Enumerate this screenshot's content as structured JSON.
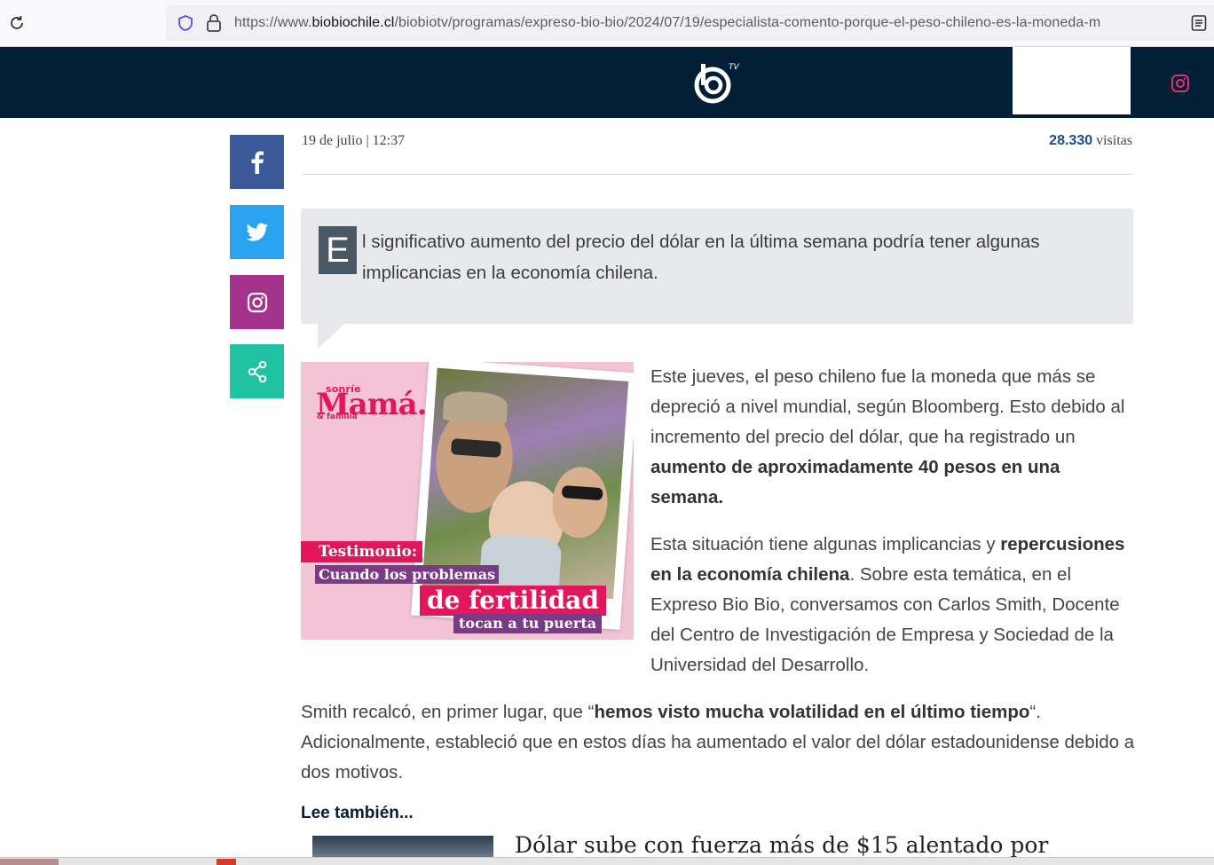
{
  "browser": {
    "url_host_prefix": "https://www.",
    "url_host": "biobiochile.cl",
    "url_path": "/biobiotv/programas/expreso-bio-bio/2024/07/19/especialista-comento-porque-el-peso-chileno-es-la-moneda-m"
  },
  "header": {
    "logo_icon": "biobiotv-logo",
    "instagram_icon": "instagram-icon",
    "accent_color": "#031f38"
  },
  "share": {
    "facebook_icon": "facebook-icon",
    "twitter_icon": "twitter-icon",
    "instagram_icon": "instagram-icon",
    "share_icon": "share-icon",
    "colors": {
      "facebook": "#3b5998",
      "twitter": "#2aa3ef",
      "instagram": "#a4338e",
      "share": "#21c2a4"
    }
  },
  "meta": {
    "date": "19 de julio | 12:37",
    "visits_count": "28.330",
    "visits_label": "visitas"
  },
  "lead": {
    "dropcap": "E",
    "text": "l significativo aumento del precio del dólar en la última semana podría tener algunas implicancias en la economía chilena."
  },
  "ad": {
    "brand_small": "sonríe",
    "brand": "Mamá.",
    "brand_sub": "& familia",
    "tag1": "Testimonio:",
    "tag2": "Cuando los problemas",
    "tag3": "de fertilidad",
    "tag4": "tocan a tu puerta"
  },
  "body": {
    "p1_a": "Este jueves, el peso chileno fue la moneda que más se depreció a nivel mundial, según Bloomberg. Esto debido al incremento del precio del dólar, que ha registrado un ",
    "p1_b": "aumento de aproximadamente 40 pesos en una semana.",
    "p2_a": "Esta situación tiene algunas implicancias y ",
    "p2_b": "repercusiones en la economía chilena",
    "p2_c": ". Sobre esta temática, en el Expreso Bio Bio, conversamos con Carlos Smith, Docente del Centro de Investigación de Empresa y Sociedad de la Universidad del Desarrollo.",
    "p3_a": "Smith recalcó, en primer lugar, que “",
    "p3_b": "hemos visto mucha volatilidad en el último tiempo",
    "p3_c": "“. Adicionalmente, estableció que en estos días ha aumentado el valor del dólar estadounidense debido a dos motivos."
  },
  "related": {
    "heading": "Lee también...",
    "title": "Dólar sube con fuerza más de $15 alentado por"
  }
}
